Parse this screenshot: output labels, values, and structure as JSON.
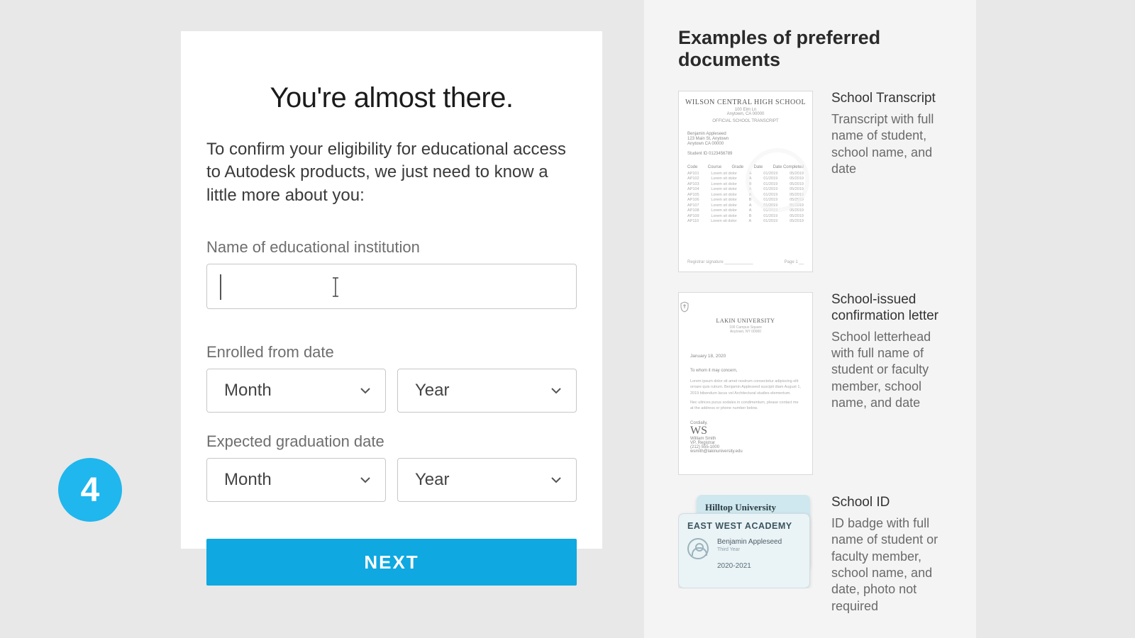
{
  "step_number": "4",
  "card": {
    "title": "You're almost there.",
    "description": "To confirm your eligibility for educational access to Autodesk products, we just need to know a little more about you:",
    "labels": {
      "institution": "Name of educational institution",
      "enrolled": "Enrolled from date",
      "graduation": "Expected graduation date"
    },
    "selects": {
      "month_placeholder": "Month",
      "year_placeholder": "Year"
    },
    "institution_value": "",
    "next_button": "NEXT"
  },
  "side": {
    "title": "Examples of preferred documents",
    "examples": [
      {
        "title": "School Transcript",
        "desc": "Transcript with full name of student, school name, and date",
        "thumb": {
          "school": "WILSON CENTRAL HIGH SCHOOL"
        }
      },
      {
        "title": "School-issued confirmation letter",
        "desc": "School letterhead with full name of student or faculty member, school name, and date",
        "thumb": {
          "uni": "LAKIN UNIVERSITY",
          "date": "January 18, 2020"
        }
      },
      {
        "title": "School ID",
        "desc": "ID badge with full name of student or faculty member, school name, and date, photo not required",
        "thumb": {
          "back_title": "Hilltop University",
          "front_title": "EAST WEST ACADEMY",
          "name": "Benjamin Appleseed",
          "year_range": "2020-2021"
        }
      }
    ]
  }
}
